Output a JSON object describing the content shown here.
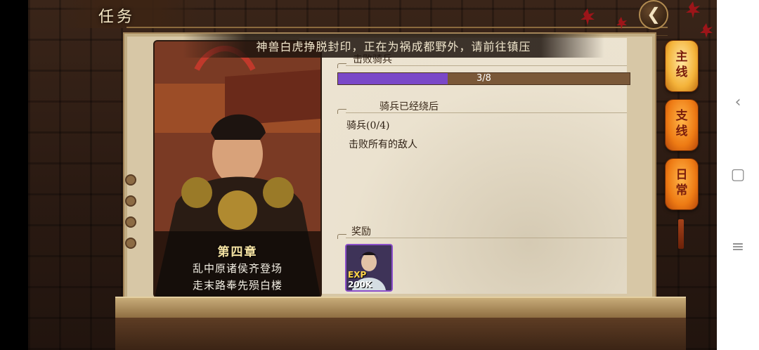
{
  "header": {
    "title": "任务"
  },
  "banner": {
    "text": "神兽白虎挣脱封印，正在为祸成都野外，请前往镇压"
  },
  "hero_card": {
    "chapter": "第四章",
    "line1": "乱中原诸侯齐登场",
    "line2": "走末路奉先殒白楼"
  },
  "task": {
    "section_title": "击败骑兵",
    "progress": {
      "current": 3,
      "total": 8,
      "label": "3/8",
      "fraction": 0.375
    },
    "sub_section_title": "骑兵已经绕后",
    "objective": "骑兵(0/4)",
    "description": "击败所有的敌人"
  },
  "rewards": {
    "section_title": "奖励",
    "items": [
      {
        "exp_label": "EXP",
        "amount": "200K"
      }
    ]
  },
  "tabs": [
    {
      "label_top": "主",
      "label_bottom": "线",
      "active": true
    },
    {
      "label_top": "支",
      "label_bottom": "线",
      "active": false
    },
    {
      "label_top": "日",
      "label_bottom": "常",
      "active": false
    }
  ],
  "android_nav": {
    "back": "‹",
    "home": "▢",
    "menu": "≡"
  },
  "colors": {
    "progress_fill": "#7a48c8",
    "tab_active": "#f4b33a",
    "tab_inactive": "#ee7b14"
  }
}
